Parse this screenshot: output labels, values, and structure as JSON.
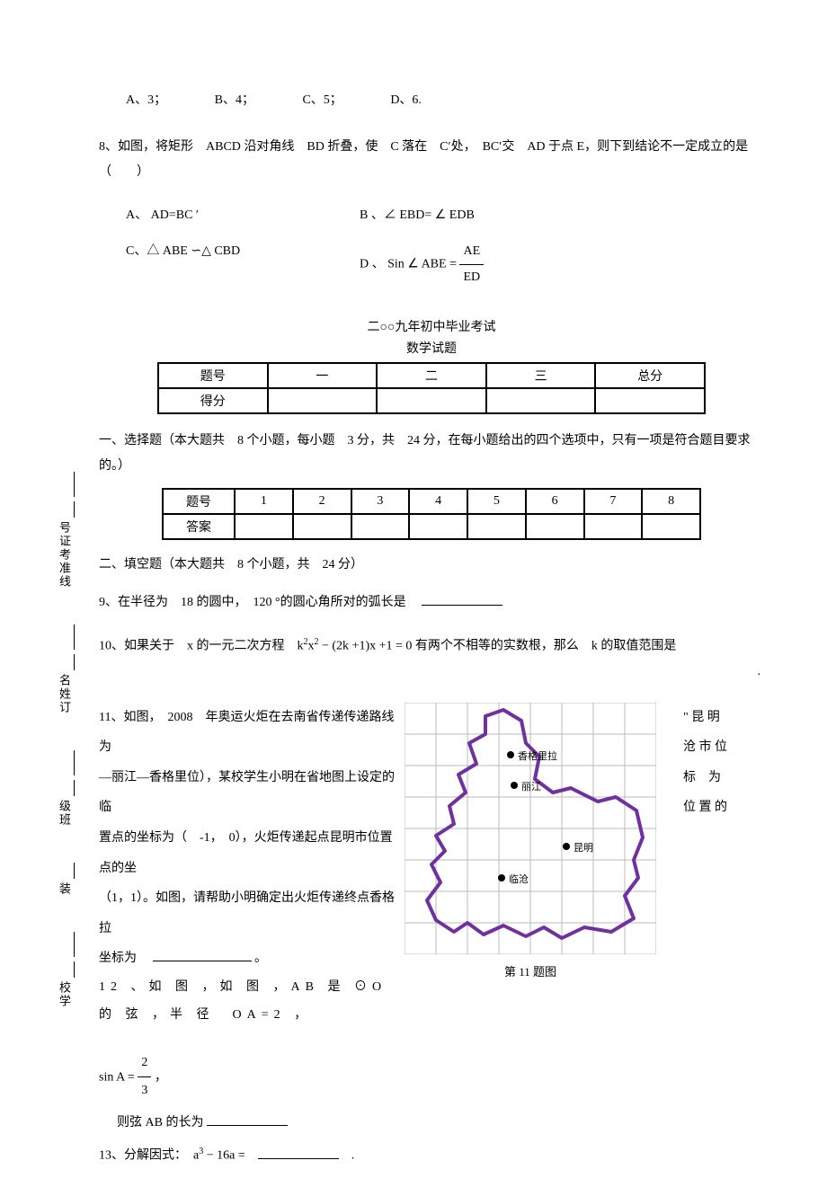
{
  "q7": {
    "A": "A、3；",
    "B": "B、4；",
    "C": "C、5；",
    "D": "D、6."
  },
  "q8": {
    "text": "8、如图，将矩形　ABCD 沿对角线　BD 折叠，使　C 落在　C′处，　BC′交　AD 于点 E，则下到结论不一定成立的是　（　　）",
    "A": "A、 AD=BC ′",
    "B": "B 、∠ EBD= ∠ EDB",
    "C": "C、△ ABE ∽△ CBD",
    "D_pre": "D 、 Sin ∠ ABE = ",
    "D_num": "AE",
    "D_den": "ED"
  },
  "examTitle": "二○○九年初中毕业考试",
  "examSubtitle": "数学试题",
  "scoreTable": {
    "h1": "题号",
    "h2": "一",
    "h3": "二",
    "h4": "三",
    "h5": "总分",
    "r2": "得分"
  },
  "section1": "一、选择题（本大题共　8 个小题，每小题　3 分，共　24 分，在每小题给出的四个选项中，只有一项是符合题目要求的。）",
  "ansTable": {
    "h1": "题号",
    "c1": "1",
    "c2": "2",
    "c3": "3",
    "c4": "4",
    "c5": "5",
    "c6": "6",
    "c7": "7",
    "c8": "8",
    "r2": "答案"
  },
  "section2": "二、填空题（本大题共　8 个小题，共　24 分）",
  "q9": {
    "pre": "9、在半径为　18 的圆中，　120 °的圆心角所对的弧长是　"
  },
  "q10": {
    "pre": "10、如果关于　x 的一元二次方程　k",
    "sup1": "2",
    "mid1": "x",
    "sup2": "2",
    "mid2": " − (2k +1)x +1 = 0 有两个不相等的实数根，那么　k 的取值范围是",
    "dot": "."
  },
  "q11": {
    "l1": "11、如图，　2008　年奥运火炬在去南省传递传递路线为",
    "r1": "\" 昆 明",
    "l2": "—丽江—香格里位），某校学生小明在省地图上设定的临",
    "r2": "沧 市 位",
    "l3": "置点的坐标为（　-1，　0），火炬传递起点昆明市位置点的坐",
    "r3": "标　为",
    "l4": "（1，1）。如图，请帮助小明确定出火炬传递终点香格拉",
    "r4": "位 置 的",
    "l5_pre": "坐标为　",
    "l5_post": "。",
    "caption": "第 11 题图",
    "cities": {
      "shangri": "香格里拉",
      "lijiang": "丽江",
      "kunming": "昆明",
      "lincang": "临沧"
    }
  },
  "q12": {
    "l1": "12 、如 图 ，如 图 ，AB 是 ⊙O 的 弦 ，半 径　OA=2 ，",
    "sin_pre": "sin A = ",
    "num": "2",
    "den": "3",
    "comma": "，",
    "l2_pre": "则弦 AB 的长为 "
  },
  "q13": {
    "pre": "13、分解因式：　a",
    "sup": "3",
    "mid": " − 16a =　",
    "post": "　."
  },
  "margin": {
    "m1": "号证考准",
    "m1b": "线",
    "m2": "名姓",
    "m2b": "订",
    "m3": "级班",
    "m4": "装",
    "m5": "校学"
  }
}
